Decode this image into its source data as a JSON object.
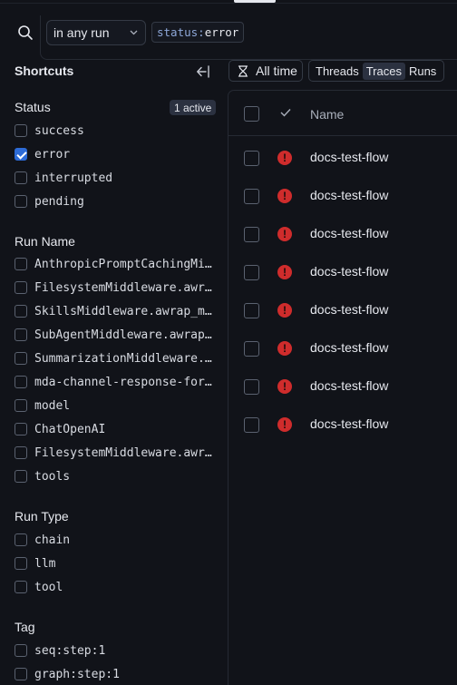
{
  "search": {
    "run_scope": "in any run",
    "filter_key": "status",
    "filter_sep": ":",
    "filter_value": "error"
  },
  "sidebar": {
    "title": "Shortcuts",
    "status": {
      "title": "Status",
      "badge": "1 active",
      "options": [
        {
          "label": "success",
          "checked": false
        },
        {
          "label": "error",
          "checked": true
        },
        {
          "label": "interrupted",
          "checked": false
        },
        {
          "label": "pending",
          "checked": false
        }
      ]
    },
    "run_name": {
      "title": "Run Name",
      "options": [
        {
          "label": "AnthropicPromptCachingMiddleware",
          "checked": false
        },
        {
          "label": "FilesystemMiddleware.awrap_model_call",
          "checked": false
        },
        {
          "label": "SkillsMiddleware.awrap_model_call",
          "checked": false
        },
        {
          "label": "SubAgentMiddleware.awrap_model_call",
          "checked": false
        },
        {
          "label": "SummarizationMiddleware.awrap_model_call",
          "checked": false
        },
        {
          "label": "mda-channel-response-formatter",
          "checked": false
        },
        {
          "label": "model",
          "checked": false
        },
        {
          "label": "ChatOpenAI",
          "checked": false
        },
        {
          "label": "FilesystemMiddleware.awrap_tool_call",
          "checked": false
        },
        {
          "label": "tools",
          "checked": false
        }
      ]
    },
    "run_type": {
      "title": "Run Type",
      "options": [
        {
          "label": "chain",
          "checked": false
        },
        {
          "label": "llm",
          "checked": false
        },
        {
          "label": "tool",
          "checked": false
        }
      ]
    },
    "tag": {
      "title": "Tag",
      "options": [
        {
          "label": "seq:step:1",
          "checked": false
        },
        {
          "label": "graph:step:1",
          "checked": false
        }
      ]
    }
  },
  "toolbar": {
    "time_label": "All time",
    "tabs": [
      {
        "label": "Threads",
        "active": false
      },
      {
        "label": "Traces",
        "active": true
      },
      {
        "label": "Runs",
        "active": false
      }
    ]
  },
  "table": {
    "name_header": "Name",
    "rows": [
      {
        "name": "docs-test-flow",
        "status": "error"
      },
      {
        "name": "docs-test-flow",
        "status": "error"
      },
      {
        "name": "docs-test-flow",
        "status": "error"
      },
      {
        "name": "docs-test-flow",
        "status": "error"
      },
      {
        "name": "docs-test-flow",
        "status": "error"
      },
      {
        "name": "docs-test-flow",
        "status": "error"
      },
      {
        "name": "docs-test-flow",
        "status": "error"
      },
      {
        "name": "docs-test-flow",
        "status": "error"
      }
    ]
  },
  "colors": {
    "background": "#111319",
    "accent": "#2d6bd6",
    "error": "#cf2c2c"
  }
}
